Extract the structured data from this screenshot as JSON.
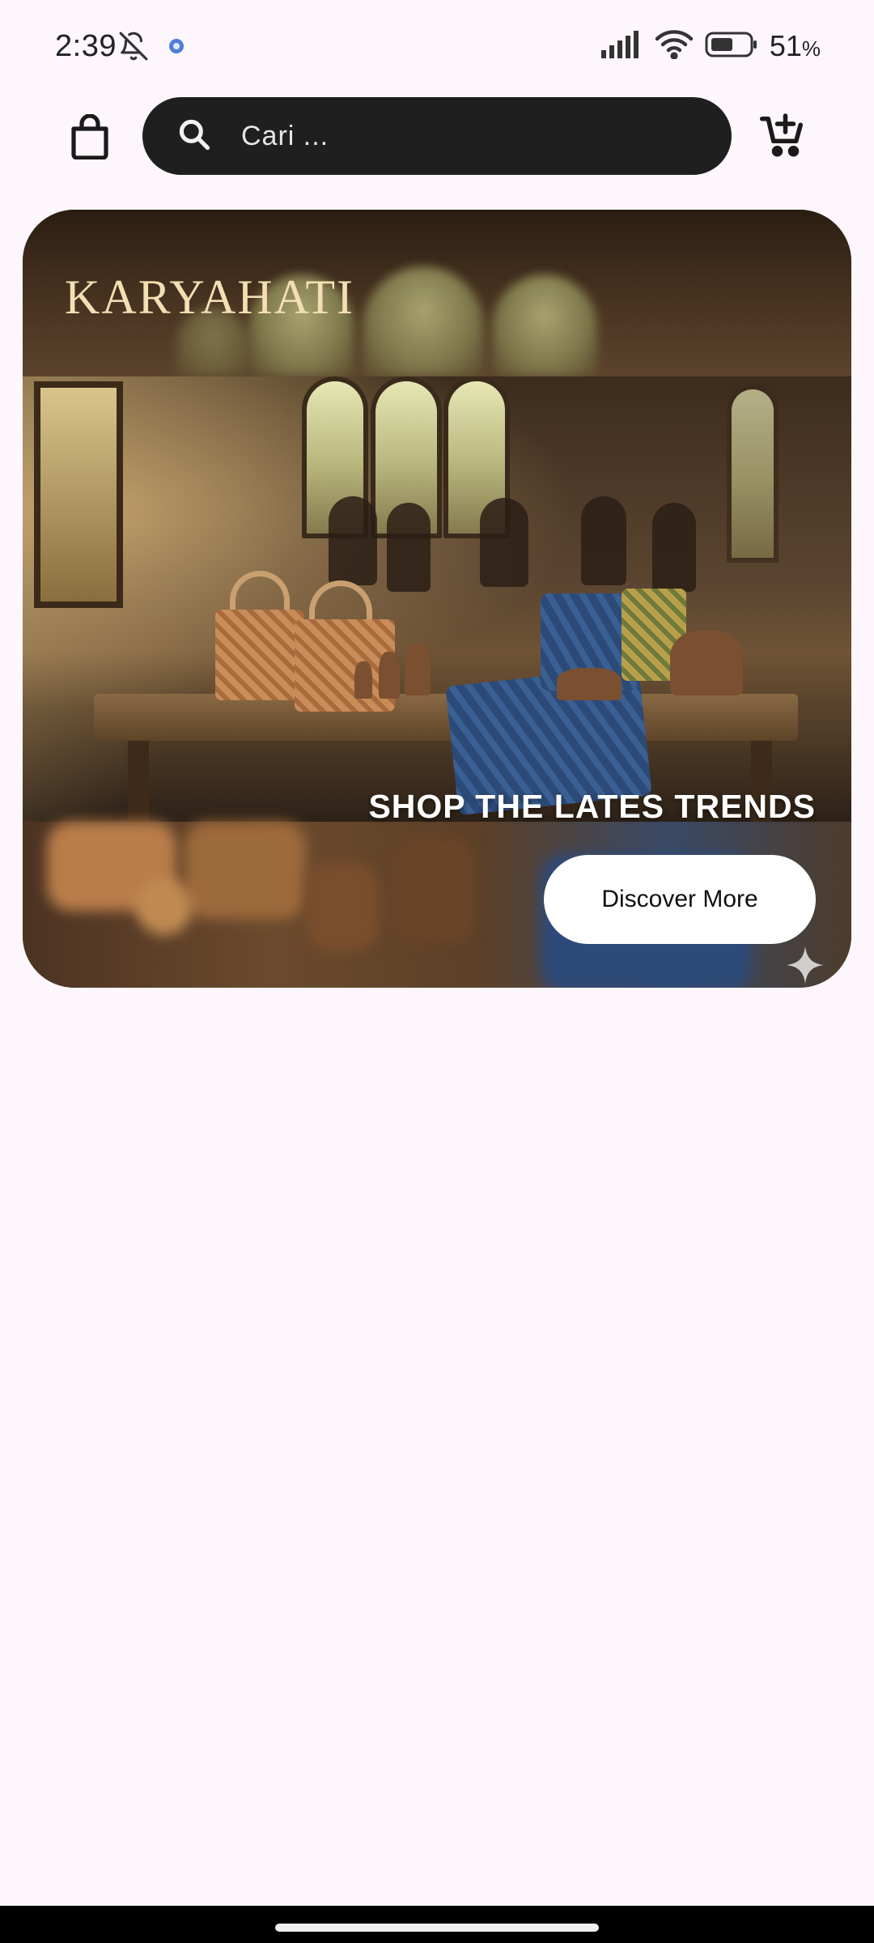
{
  "status_bar": {
    "time": "2:39",
    "battery_percent": "51",
    "battery_unit": "%",
    "icons": [
      "bell-off-icon",
      "app-notification-icon",
      "signal-icon",
      "wifi-icon",
      "battery-icon"
    ]
  },
  "app_bar": {
    "search_placeholder": "Cari ...",
    "icons": [
      "shopping-bag-icon",
      "search-icon",
      "add-to-cart-icon"
    ]
  },
  "banner": {
    "brand": "KARYAHATI",
    "headline": "SHOP THE LATES TRENDS",
    "cta_label": "Discover More"
  },
  "colors": {
    "background": "#fdf6fc",
    "search_bar": "#1f1f1f",
    "button": "#ffffff",
    "brand_text": "#f3dfb3"
  }
}
